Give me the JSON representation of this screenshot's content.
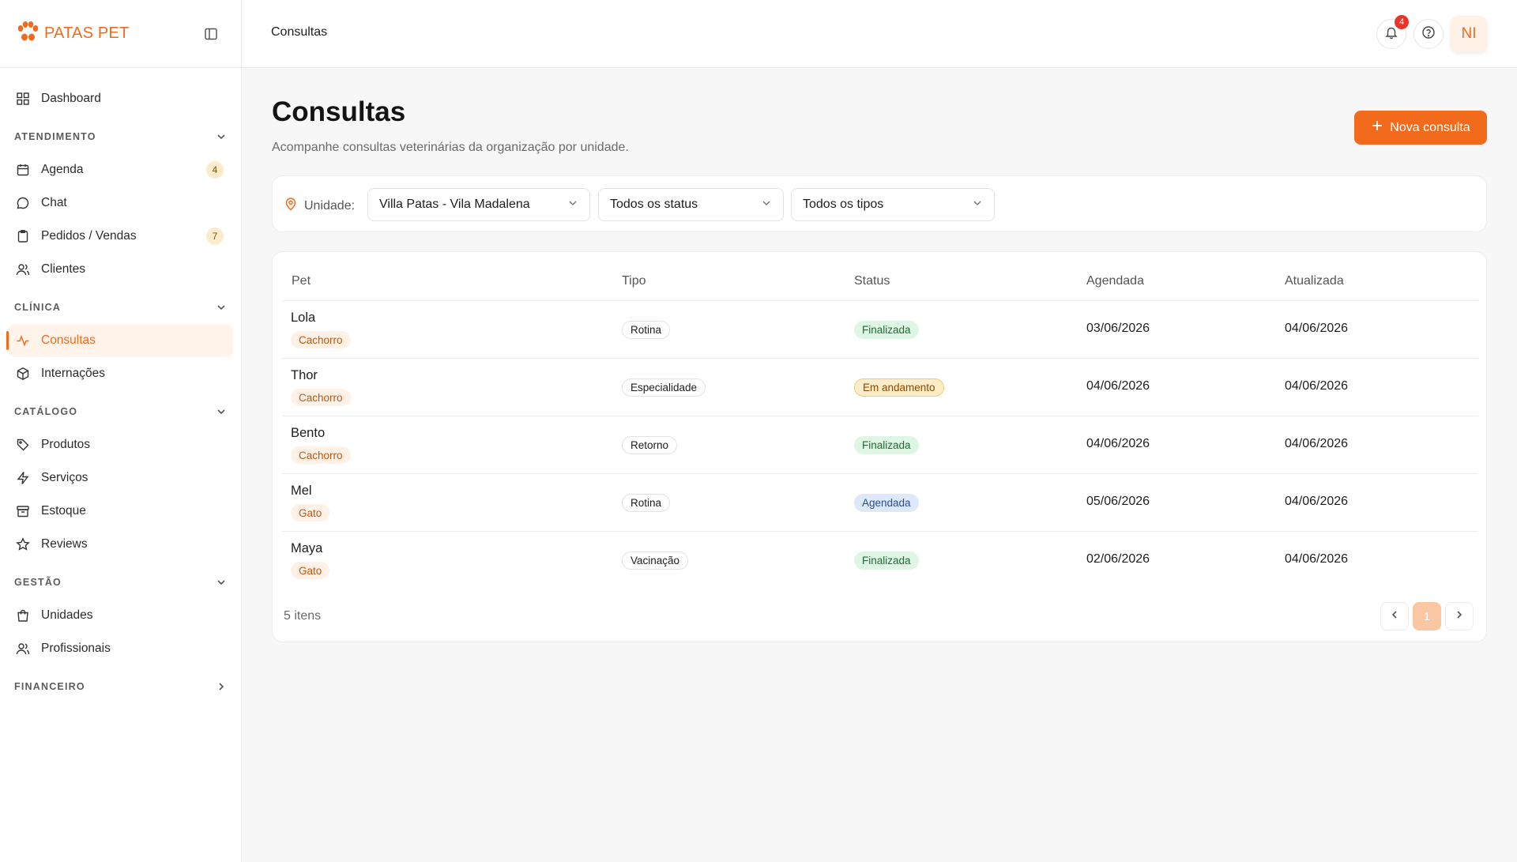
{
  "app": {
    "name": "PATAS PET"
  },
  "sidebar": {
    "dashboard": "Dashboard",
    "sections": {
      "atendimento": "ATENDIMENTO",
      "clinica": "CLÍNICA",
      "catalogo": "CATÁLOGO",
      "gestao": "GESTÃO",
      "financeiro": "FINANCEIRO"
    },
    "items": {
      "agenda": {
        "label": "Agenda",
        "badge": "4"
      },
      "chat": {
        "label": "Chat"
      },
      "pedidos": {
        "label": "Pedidos / Vendas",
        "badge": "7"
      },
      "clientes": {
        "label": "Clientes"
      },
      "consultas": {
        "label": "Consultas"
      },
      "internacoes": {
        "label": "Internações"
      },
      "produtos": {
        "label": "Produtos"
      },
      "servicos": {
        "label": "Serviços"
      },
      "estoque": {
        "label": "Estoque"
      },
      "reviews": {
        "label": "Reviews"
      },
      "unidades": {
        "label": "Unidades"
      },
      "profissionais": {
        "label": "Profissionais"
      }
    }
  },
  "topbar": {
    "title": "Consultas",
    "notifications_count": "4",
    "avatar_initials": "NI"
  },
  "page": {
    "title": "Consultas",
    "subtitle": "Acompanhe consultas veterinárias da organização por unidade.",
    "new_button": "Nova consulta"
  },
  "filters": {
    "unit_label": "Unidade:",
    "unit_value": "Villa Patas - Vila Madalena",
    "status_value": "Todos os status",
    "type_value": "Todos os tipos"
  },
  "table": {
    "headers": {
      "pet": "Pet",
      "tipo": "Tipo",
      "status": "Status",
      "agendada": "Agendada",
      "atualizada": "Atualizada"
    },
    "rows": [
      {
        "pet": "Lola",
        "species": "Cachorro",
        "tipo": "Rotina",
        "status": "Finalizada",
        "agendada": "03/06/2026",
        "atualizada": "04/06/2026"
      },
      {
        "pet": "Thor",
        "species": "Cachorro",
        "tipo": "Especialidade",
        "status": "Em andamento",
        "agendada": "04/06/2026",
        "atualizada": "04/06/2026"
      },
      {
        "pet": "Bento",
        "species": "Cachorro",
        "tipo": "Retorno",
        "status": "Finalizada",
        "agendada": "04/06/2026",
        "atualizada": "04/06/2026"
      },
      {
        "pet": "Mel",
        "species": "Gato",
        "tipo": "Rotina",
        "status": "Agendada",
        "agendada": "05/06/2026",
        "atualizada": "04/06/2026"
      },
      {
        "pet": "Maya",
        "species": "Gato",
        "tipo": "Vacinação",
        "status": "Finalizada",
        "agendada": "02/06/2026",
        "atualizada": "04/06/2026"
      }
    ],
    "count_label": "5 itens",
    "current_page": "1"
  },
  "colors": {
    "brand": "#f26b1d",
    "success": "#1f6b34",
    "warning": "#8a4a00",
    "info": "#2a4f88"
  }
}
